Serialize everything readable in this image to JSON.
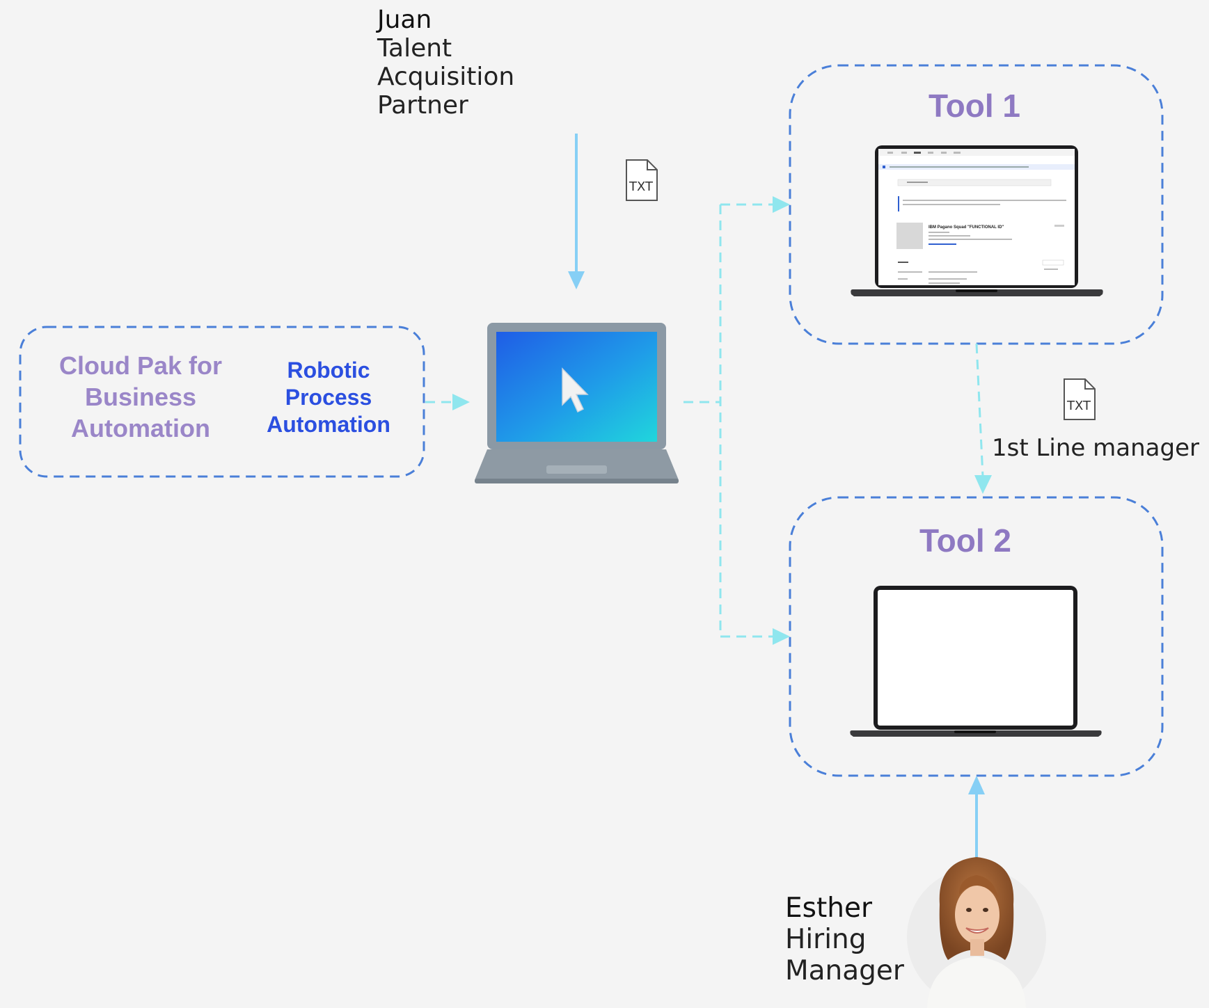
{
  "juan": {
    "name": "Juan",
    "role_lines": [
      "Talent",
      "Acquisition",
      "Partner"
    ]
  },
  "esther": {
    "name": "Esther",
    "role_lines": [
      "Hiring",
      "Manager"
    ]
  },
  "automation_box": {
    "cpba_lines": [
      "Cloud Pak for",
      "Business",
      "Automation"
    ],
    "rpa_lines": [
      "Robotic",
      "Process",
      "Automation"
    ]
  },
  "tool1": {
    "title": "Tool 1",
    "screen_heading": "IBM Pagano Squad \"FUNCTIONAL ID\""
  },
  "tool2": {
    "title": "Tool 2"
  },
  "file_icons": {
    "label": "TXT"
  },
  "flow_label": "1st Line manager",
  "icons": [
    "txt-file-icon",
    "laptop-icon",
    "cursor-icon",
    "avatar"
  ],
  "colors": {
    "background": "#f4f4f4",
    "dashed_box": "#4a7fd8",
    "dashed_connector": "#8fe6ee",
    "solid_arrow": "#86cff5",
    "title_purple": "#8e79c2",
    "rpa_blue": "#2b4fe0"
  }
}
